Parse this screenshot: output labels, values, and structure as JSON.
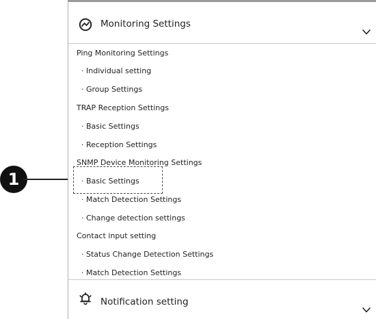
{
  "monitoring": {
    "title": "Monitoring Settings",
    "icon": "chart-trend-icon",
    "chevron": "chevron-down-icon"
  },
  "menu": [
    {
      "label": "Ping Monitoring Settings",
      "level": 1
    },
    {
      "label": "· Individual setting",
      "level": 2
    },
    {
      "label": "· Group Settings",
      "level": 2
    },
    {
      "label": "TRAP Reception Settings",
      "level": 1
    },
    {
      "label": "· Basic Settings",
      "level": 2
    },
    {
      "label": "· Reception Settings",
      "level": 2
    },
    {
      "label": "SNMP Device Monitoring Settings",
      "level": 1
    },
    {
      "label": "· Basic Settings",
      "level": 2,
      "highlighted": true
    },
    {
      "label": "· Match Detection Settings",
      "level": 2
    },
    {
      "label": "· Change detection settings",
      "level": 2
    },
    {
      "label": "Contact input setting",
      "level": 1
    },
    {
      "label": "· Status Change Detection Settings",
      "level": 2
    },
    {
      "label": "· Match Detection Settings",
      "level": 2
    }
  ],
  "notification": {
    "title": "Notification setting",
    "icon": "bell-icon",
    "chevron": "chevron-down-icon"
  },
  "callout": {
    "number": "1"
  },
  "colors": {
    "text": "#222222",
    "border": "#b0b0b0",
    "callout_fill": "#111111"
  }
}
